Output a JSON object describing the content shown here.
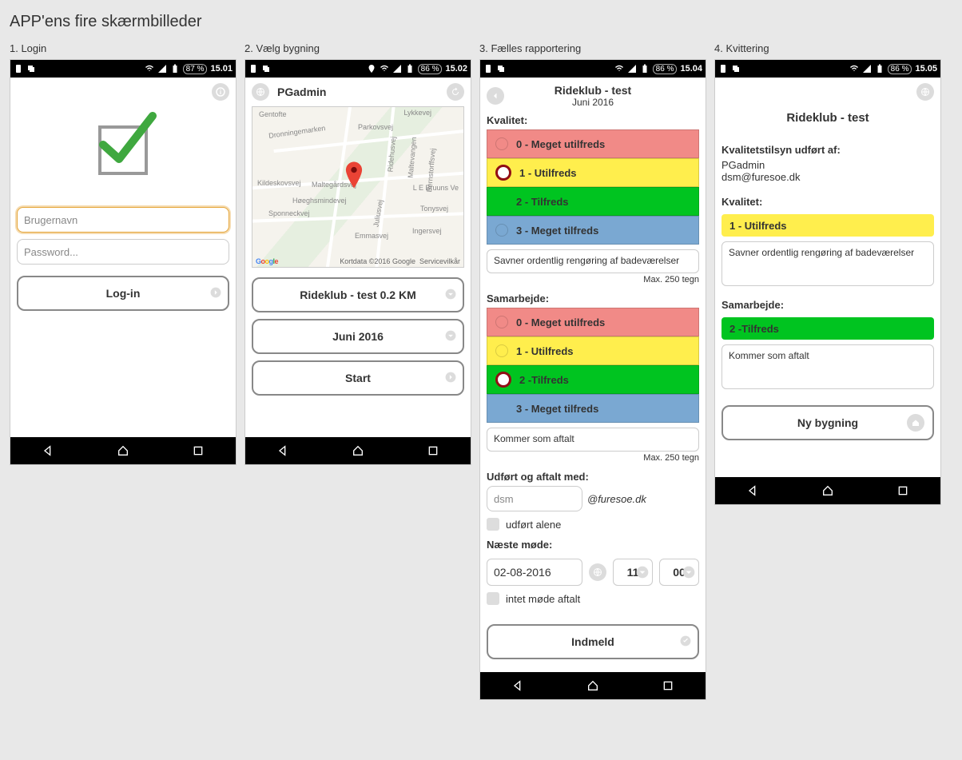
{
  "title": "APP'ens fire skærmbilleder",
  "screens": [
    {
      "caption": "1. Login",
      "battery": "87 %",
      "time": "15.01"
    },
    {
      "caption": "2. Vælg bygning",
      "battery": "86 %",
      "time": "15.02"
    },
    {
      "caption": "3. Fælles rapportering",
      "battery": "86 %",
      "time": "15.04"
    },
    {
      "caption": "4. Kvittering",
      "battery": "86 %",
      "time": "15.05"
    }
  ],
  "login": {
    "username_placeholder": "Brugernavn",
    "password_placeholder": "Password...",
    "login_btn": "Log-in"
  },
  "select": {
    "user": "PGadmin",
    "map": {
      "copyright": "Kortdata ©2016 Google",
      "terms": "Servicevilkår",
      "labels": {
        "gentofte": "Gentofte",
        "dronningemarken": "Dronningemarken",
        "hoeghsmindevej": "Høeghsmindevej",
        "parkovsvej": "Parkovsvej",
        "lykkevej": "Lykkevej",
        "maltegardsvej": "Maltegårdsvej",
        "ridehusvej": "Ridehusvej",
        "maltevangen": "Maltevangen",
        "bernstorffsvej": "Bernstorffsvej",
        "tonysvej": "Tonysvej",
        "ingersvej": "Ingersvej",
        "emmasvej": "Emmasvej",
        "juliusvej": "Juliusvej",
        "kildeskovsvej": "Kildeskovsvej",
        "sponneckvej": "Sponneckvej",
        "bruuns": "L E Bruuns Ve"
      }
    },
    "building_btn": "Rideklub - test 0.2 KM",
    "month_btn": "Juni 2016",
    "start_btn": "Start"
  },
  "report": {
    "title": "Rideklub - test",
    "subtitle": "Juni 2016",
    "kvalitet_label": "Kvalitet:",
    "samarbejde_label": "Samarbejde:",
    "quality_options": [
      "0 - Meget utilfreds",
      "1 - Utilfreds",
      "2 - Tilfreds",
      "3 - Meget tilfreds"
    ],
    "quality_selected": 1,
    "quality_comment": "Savner ordentlig rengøring af badeværelser",
    "coop_options": [
      "0 - Meget utilfreds",
      "1 - Utilfreds",
      "2 -Tilfreds",
      "3 - Meget tilfreds"
    ],
    "coop_selected": 2,
    "coop_comment": "Kommer som aftalt",
    "max_label": "Max. 250 tegn",
    "udfort_label": "Udført og aftalt med:",
    "udfort_value": "dsm",
    "udfort_domain": "@furesoe.dk",
    "udfort_alene": "udført alene",
    "naeste_label": "Næste møde:",
    "naeste_date": "02-08-2016",
    "naeste_hour": "11",
    "naeste_min": "00",
    "intet_mode": "intet møde aftalt",
    "submit": "Indmeld"
  },
  "receipt": {
    "title": "Rideklub - test",
    "by_label": "Kvalitetstilsyn udført af:",
    "by_user": "PGadmin",
    "by_mail": "dsm@furesoe.dk",
    "kvalitet_label": "Kvalitet:",
    "kvalitet_value": "1 - Utilfreds",
    "kvalitet_comment": "Savner ordentlig rengøring af badeværelser",
    "samarbejde_label": "Samarbejde:",
    "samarbejde_value": "2 -Tilfreds",
    "samarbejde_comment": "Kommer som aftalt",
    "new_building": "Ny bygning"
  }
}
